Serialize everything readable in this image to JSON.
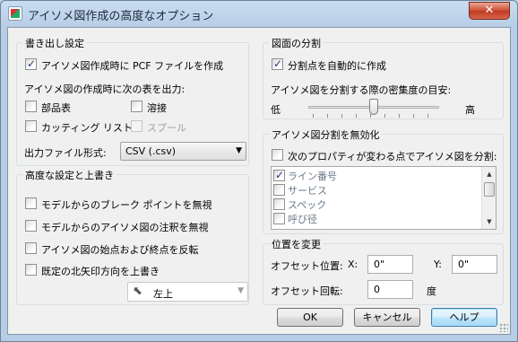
{
  "window": {
    "title": "アイソメ図作成の高度なオプション",
    "close_label": "✕"
  },
  "export": {
    "title": "書き出し設定",
    "create_pcf": {
      "label": "アイソメ図作成時に PCF ファイルを作成",
      "checked": true
    },
    "tables_label": "アイソメ図の作成時に次の表を出力:",
    "parts_list": {
      "label": "部品表",
      "checked": false
    },
    "welds": {
      "label": "溶接",
      "checked": false
    },
    "cut_list": {
      "label": "カッティング リスト",
      "checked": false
    },
    "spools": {
      "label": "スプール",
      "checked": false,
      "disabled": true
    },
    "format_label": "出力ファイル形式:",
    "format_value": "CSV (.csv)"
  },
  "advanced": {
    "title": "高度な設定と上書き",
    "ignore_breaks": {
      "label": "モデルからのブレーク ポイントを無視",
      "checked": false
    },
    "ignore_annotations": {
      "label": "モデルからのアイソメ図の注釈を無視",
      "checked": false
    },
    "reverse_points": {
      "label": "アイソメ図の始点および終点を反転",
      "checked": false
    },
    "override_north": {
      "label": "既定の北矢印方向を上書き",
      "checked": false
    },
    "north_direction": "左上"
  },
  "split": {
    "title": "図面の分割",
    "auto_split": {
      "label": "分割点を自動的に作成",
      "checked": true
    },
    "density_label": "アイソメ図を分割する際の密集度の目安:",
    "low_label": "低",
    "high_label": "高",
    "density_level": 0.5
  },
  "disable": {
    "title": "アイソメ図分割を無効化",
    "split_on_change": {
      "label": "次のプロパティが変わる点でアイソメ図を分割:",
      "checked": false
    },
    "properties": [
      {
        "label": "ライン番号",
        "checked": true
      },
      {
        "label": "サービス",
        "checked": false
      },
      {
        "label": "スペック",
        "checked": false
      },
      {
        "label": "呼び径",
        "checked": false
      }
    ]
  },
  "position": {
    "title": "位置を変更",
    "offset_position_label": "オフセット位置:",
    "x_label": "X:",
    "x_value": "0\"",
    "y_label": "Y:",
    "y_value": "0\"",
    "offset_rotation_label": "オフセット回転:",
    "rotation_value": "0",
    "degree_label": "度"
  },
  "buttons": {
    "ok": "OK",
    "cancel": "キャンセル",
    "help": "ヘルプ"
  },
  "colors": {
    "title_bar": "#b7cde6",
    "close_button": "#c0391f",
    "client_bg": "#f0f0f0"
  }
}
